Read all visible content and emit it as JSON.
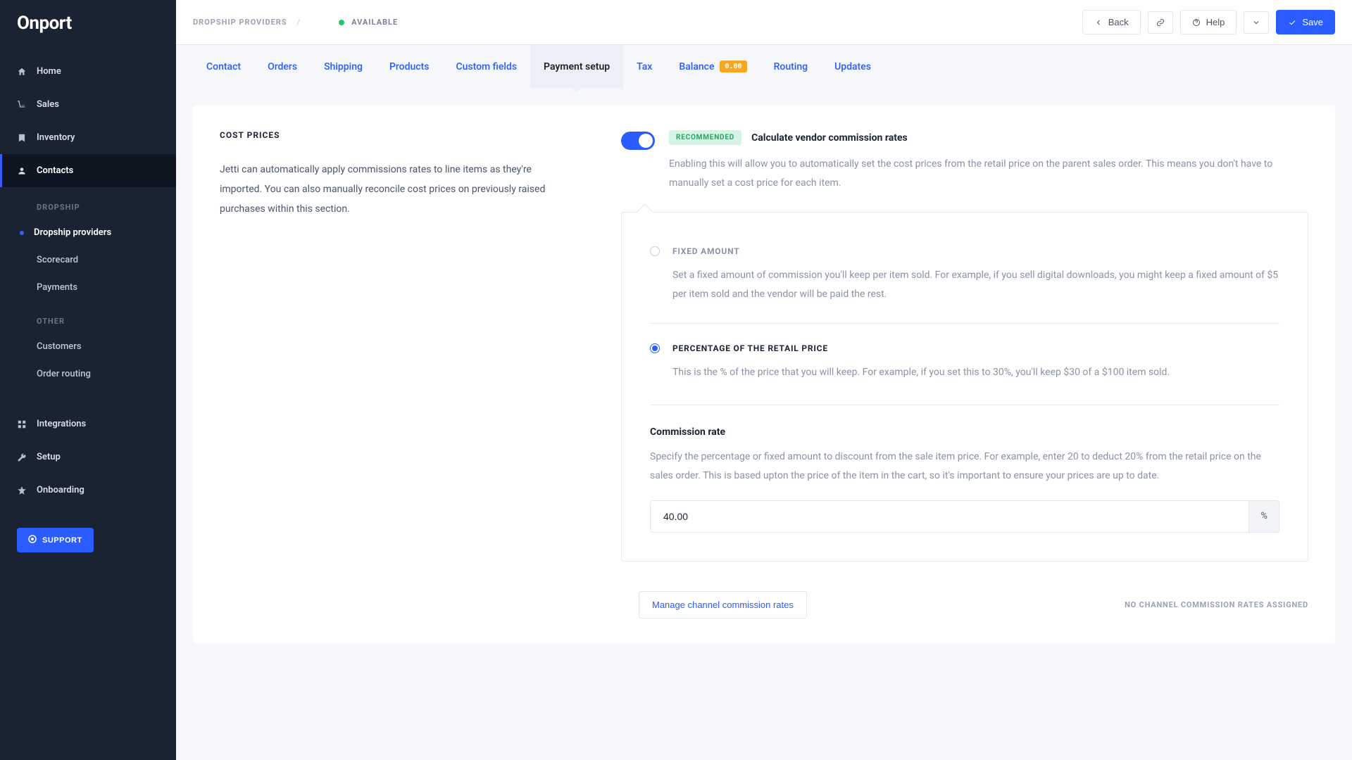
{
  "logo": "Onport",
  "sidebar": {
    "main_items": [
      {
        "label": "Home"
      },
      {
        "label": "Sales"
      },
      {
        "label": "Inventory"
      },
      {
        "label": "Contacts"
      }
    ],
    "dropship_label": "DROPSHIP",
    "dropship_items": [
      {
        "label": "Dropship providers"
      },
      {
        "label": "Scorecard"
      },
      {
        "label": "Payments"
      }
    ],
    "other_label": "OTHER",
    "other_items": [
      {
        "label": "Customers"
      },
      {
        "label": "Order routing"
      }
    ],
    "bottom_items": [
      {
        "label": "Integrations"
      },
      {
        "label": "Setup"
      },
      {
        "label": "Onboarding"
      }
    ],
    "support_label": "SUPPORT"
  },
  "topbar": {
    "breadcrumb": "DROPSHIP PROVIDERS",
    "slash": "/",
    "status": "AVAILABLE",
    "back": "Back",
    "help": "Help",
    "save": "Save"
  },
  "tabs": [
    {
      "label": "Contact"
    },
    {
      "label": "Orders"
    },
    {
      "label": "Shipping"
    },
    {
      "label": "Products"
    },
    {
      "label": "Custom fields"
    },
    {
      "label": "Payment setup"
    },
    {
      "label": "Tax"
    },
    {
      "label": "Balance"
    },
    {
      "label": "Routing"
    },
    {
      "label": "Updates"
    }
  ],
  "balance_badge": "0.00",
  "section": {
    "title": "COST PRICES",
    "description": "Jetti can automatically apply commissions rates to line items as they're imported. You can also manually reconcile cost prices on previously raised purchases within this section."
  },
  "setting": {
    "recommended": "RECOMMENDED",
    "title": "Calculate vendor commission rates",
    "desc": "Enabling this will allow you to automatically set the cost prices from the retail price on the parent sales order. This means you don't have to manually set a cost price for each item."
  },
  "options": {
    "fixed": {
      "title": "FIXED AMOUNT",
      "desc": "Set a fixed amount of commission you'll keep per item sold. For example, if you sell digital downloads, you might keep a fixed amount of $5 per item sold and the vendor will be paid the rest."
    },
    "percentage": {
      "title": "PERCENTAGE OF THE RETAIL PRICE",
      "desc": "This is the % of the price that you will keep. For example, if you set this to 30%, you'll keep $30 of a $100 item sold."
    }
  },
  "commission": {
    "label": "Commission rate",
    "desc": "Specify the percentage or fixed amount to discount from the sale item price. For example, enter 20 to deduct 20% from the retail price on the sales order. This is based upton the price of the item in the cart, so it's important to ensure your prices are up to date.",
    "value": "40.00",
    "suffix": "%"
  },
  "footer": {
    "manage": "Manage channel commission rates",
    "note": "NO CHANNEL COMMISSION RATES ASSIGNED"
  }
}
